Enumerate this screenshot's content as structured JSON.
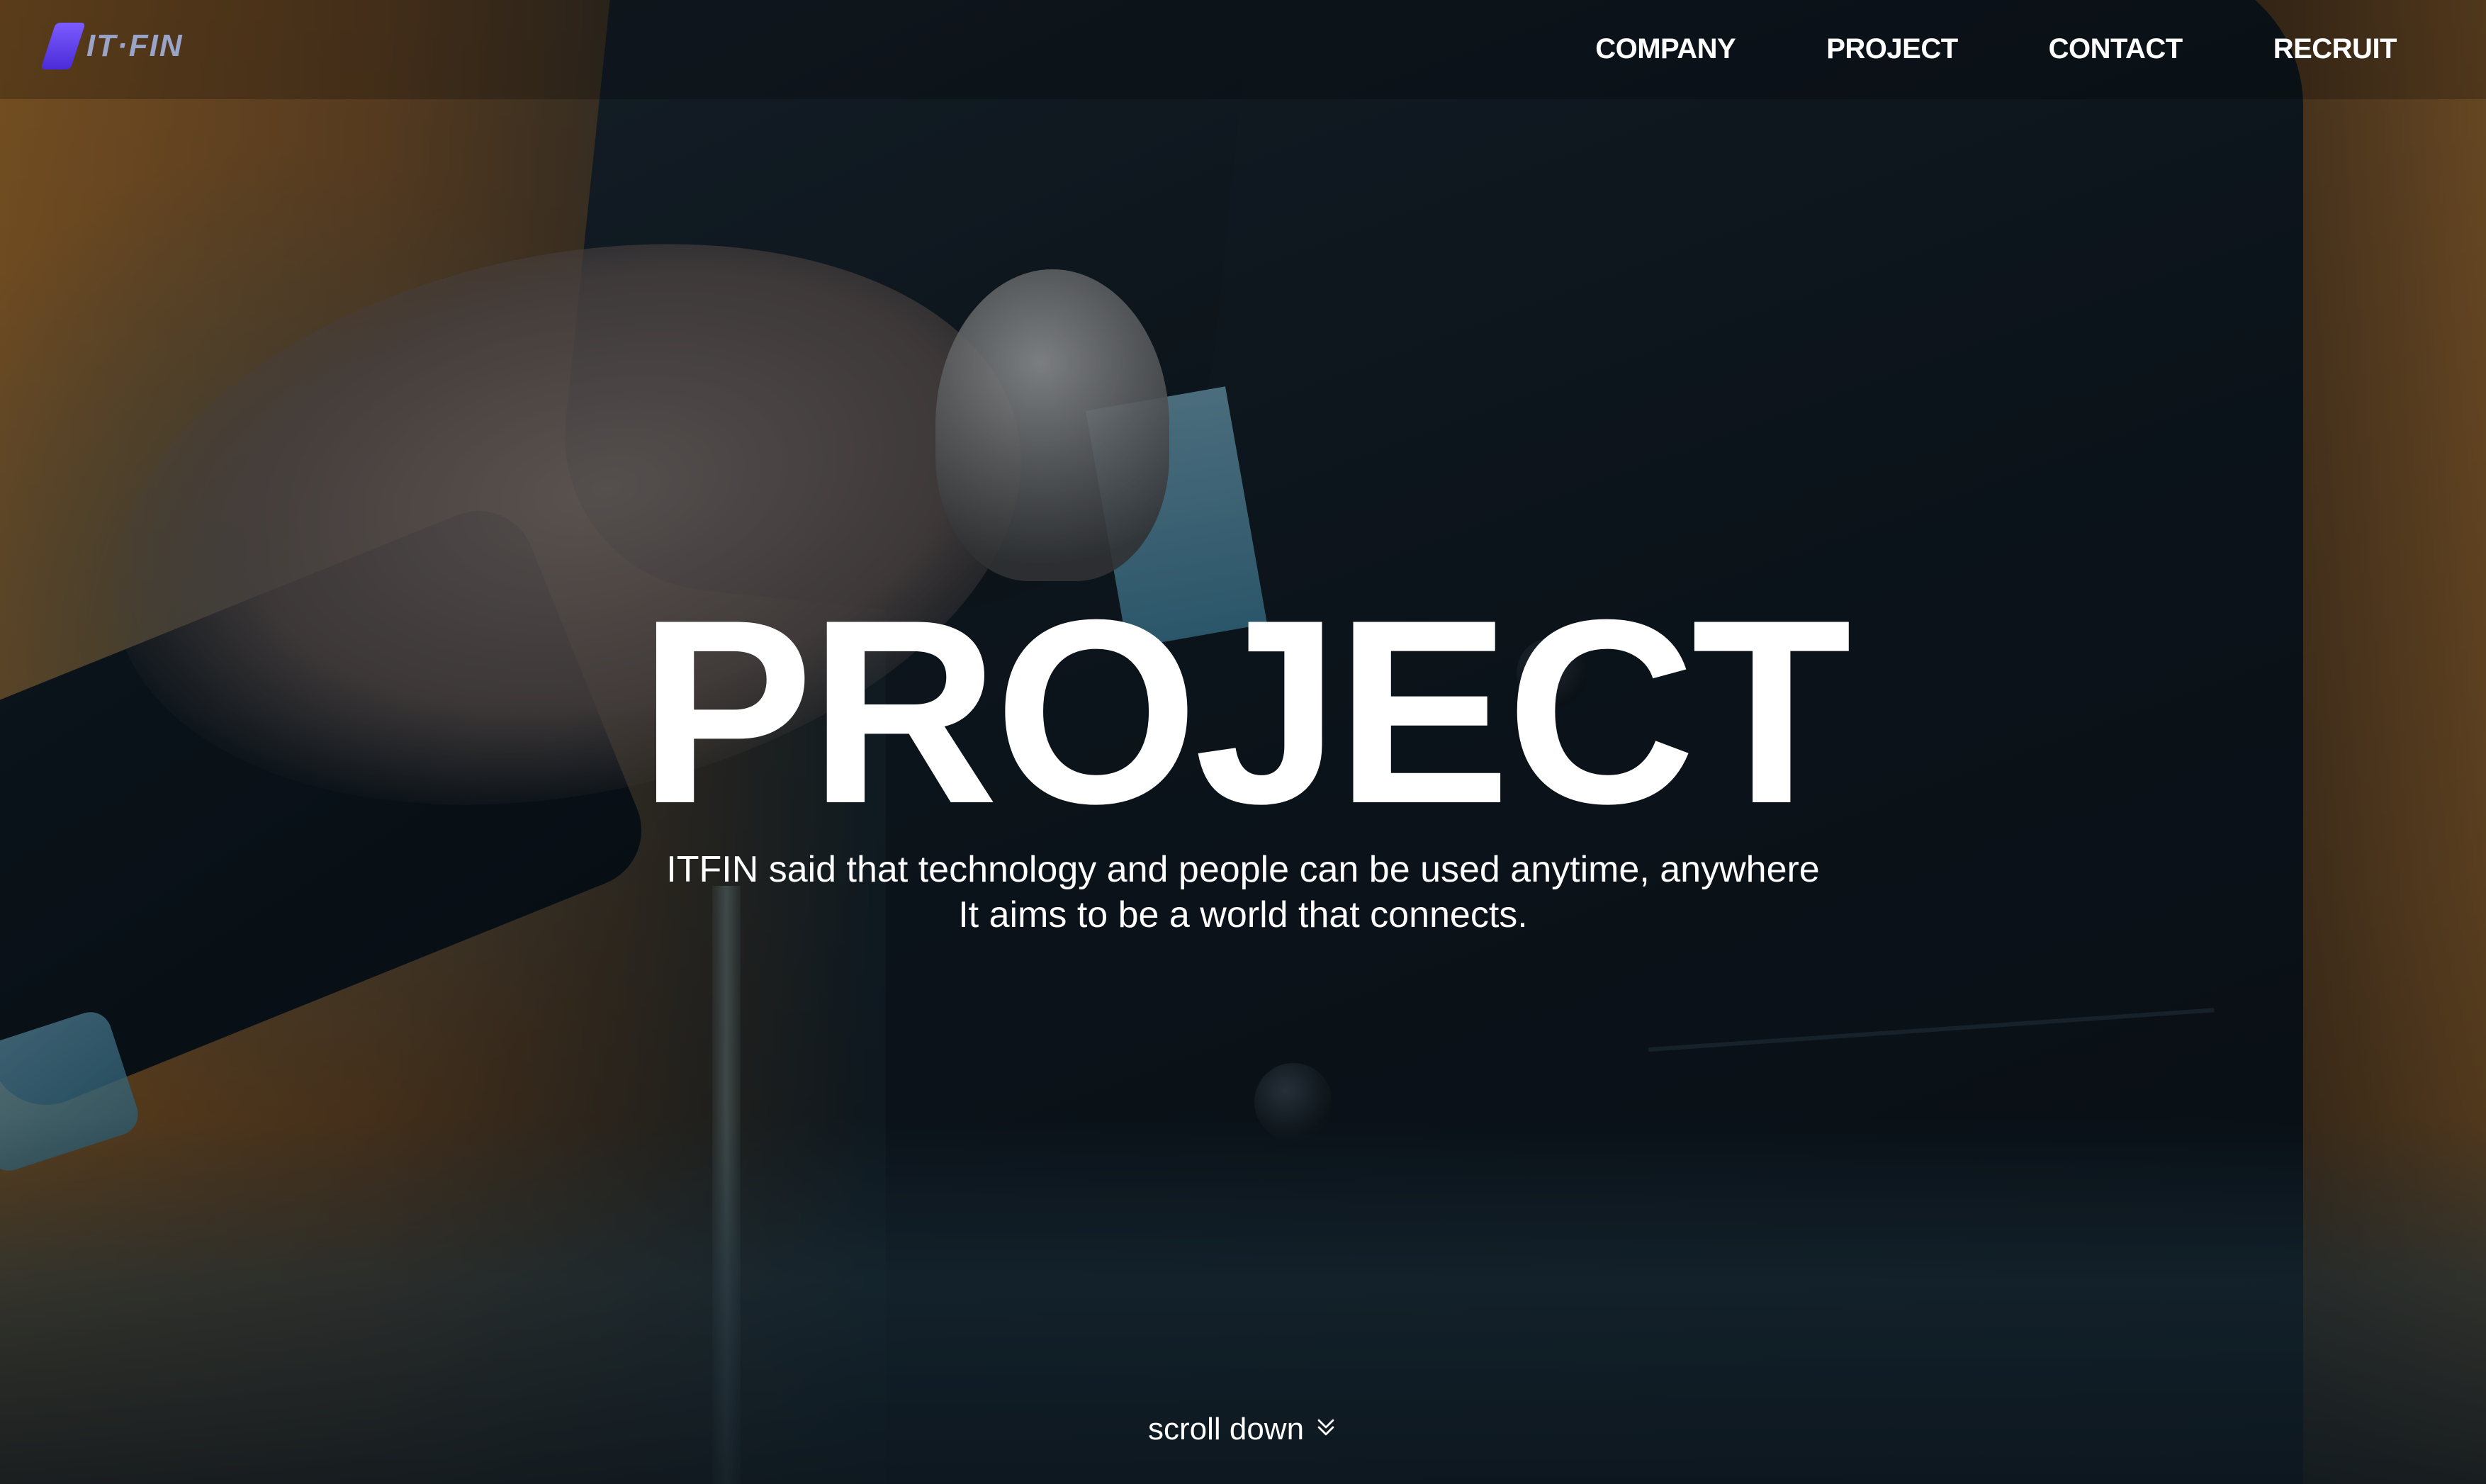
{
  "header": {
    "logo_text": "IT·FIN",
    "nav": [
      {
        "label": "COMPANY"
      },
      {
        "label": "PROJECT"
      },
      {
        "label": "CONTACT"
      },
      {
        "label": "RECRUIT"
      }
    ]
  },
  "hero": {
    "title": "PROJECT",
    "tagline_line1": "ITFIN said that technology and people can be used anytime, anywhere",
    "tagline_line2": "It aims to be a world that connects.",
    "scroll_label": "scroll down",
    "scroll_icon": "double-chevron-down-icon"
  },
  "colors": {
    "text": "#ffffff",
    "logo_mark": "#6a4cf0",
    "logo_text": "#9aa3c8"
  }
}
